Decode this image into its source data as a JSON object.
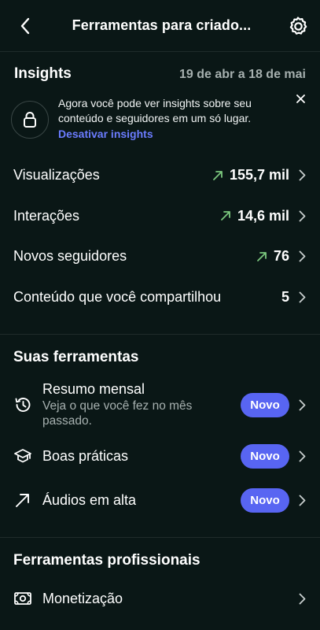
{
  "header": {
    "title": "Ferramentas para criado...",
    "back_icon": "chevron-left-icon",
    "settings_icon": "gear-icon"
  },
  "insights": {
    "heading": "Insights",
    "date_range": "19 de abr a 18 de mai",
    "notice": {
      "text": "Agora você pode ver insights sobre seu conteúdo e seguidores em um só lugar.",
      "link": "Desativar insights",
      "icon": "lock-icon"
    },
    "metrics": [
      {
        "label": "Visualizações",
        "value": "155,7 mil",
        "trend": "up"
      },
      {
        "label": "Interações",
        "value": "14,6 mil",
        "trend": "up"
      },
      {
        "label": "Novos seguidores",
        "value": "76",
        "trend": "up"
      },
      {
        "label": "Conteúdo que você compartilhou",
        "value": "5",
        "trend": ""
      }
    ]
  },
  "tools": {
    "heading": "Suas ferramentas",
    "items": [
      {
        "name": "Resumo mensal",
        "sub": "Veja o que você fez no mês passado.",
        "badge": "Novo",
        "icon": "history-icon"
      },
      {
        "name": "Boas práticas",
        "sub": "",
        "badge": "Novo",
        "icon": "graduation-cap-icon"
      },
      {
        "name": "Áudios em alta",
        "sub": "",
        "badge": "Novo",
        "icon": "trending-arrow-icon"
      }
    ]
  },
  "pro_tools": {
    "heading": "Ferramentas profissionais",
    "items": [
      {
        "name": "Monetização",
        "icon": "money-icon"
      }
    ]
  },
  "colors": {
    "background": "#0a1716",
    "accent": "#5865f2",
    "link": "#6b7cff",
    "trend_up": "#7bc77e",
    "muted": "#a6b0af"
  }
}
